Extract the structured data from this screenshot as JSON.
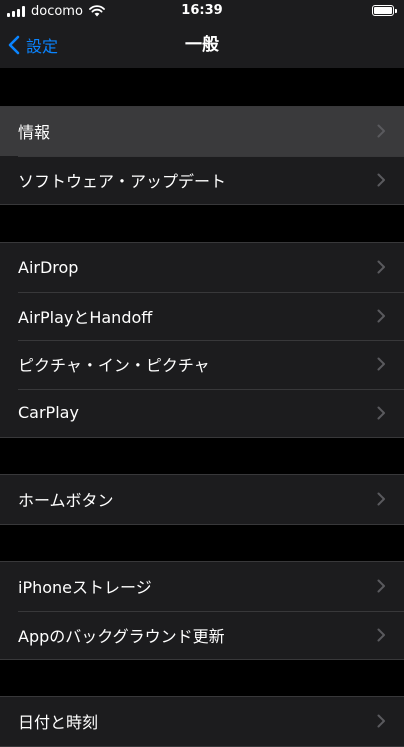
{
  "status_bar": {
    "carrier": "docomo",
    "time": "16:39"
  },
  "nav": {
    "back_label": "設定",
    "title": "一般"
  },
  "groups": [
    {
      "items": [
        {
          "label": "情報"
        },
        {
          "label": "ソフトウェア・アップデート"
        }
      ]
    },
    {
      "items": [
        {
          "label": "AirDrop"
        },
        {
          "label": "AirPlayとHandoff"
        },
        {
          "label": "ピクチャ・イン・ピクチャ"
        },
        {
          "label": "CarPlay"
        }
      ]
    },
    {
      "items": [
        {
          "label": "ホームボタン"
        }
      ]
    },
    {
      "items": [
        {
          "label": "iPhoneストレージ"
        },
        {
          "label": "Appのバックグラウンド更新"
        }
      ]
    },
    {
      "items": [
        {
          "label": "日付と時刻"
        }
      ]
    }
  ],
  "colors": {
    "accent": "#0a84ff",
    "background": "#000000",
    "cell": "#1c1c1e",
    "cell_highlighted": "#3a3a3c",
    "chevron": "#5a5a5e"
  },
  "icons": [
    "signal-icon",
    "wifi-icon",
    "battery-icon",
    "chevron-left-icon",
    "chevron-right-icon"
  ]
}
